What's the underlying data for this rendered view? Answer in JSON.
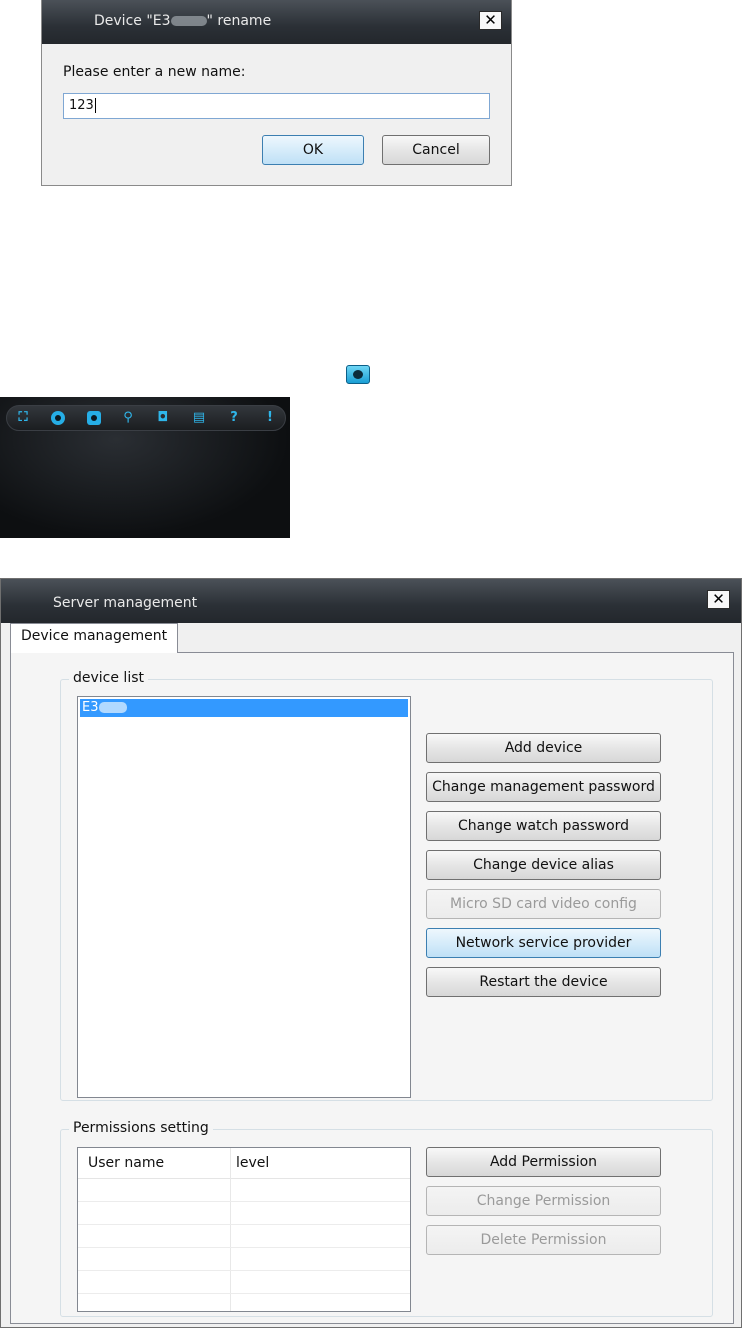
{
  "rename_dialog": {
    "title_prefix": "Device \"E3",
    "title_suffix": "\" rename",
    "close_label": "✕",
    "prompt": "Please enter a new name:",
    "input_value": "123",
    "ok_label": "OK",
    "cancel_label": "Cancel"
  },
  "toolbar": {
    "icons": [
      "fullscreen-icon",
      "record-icon",
      "snapshot-icon",
      "search-icon",
      "lock-icon",
      "storage-icon",
      "help-icon",
      "alert-icon"
    ],
    "accent": "#26aee6"
  },
  "server_window": {
    "title": "Server management",
    "close_label": "✕",
    "tab_label": "Device management",
    "device_group_label": "device list",
    "devices": [
      {
        "name_prefix": "E3"
      }
    ],
    "device_buttons": {
      "add": "Add device",
      "change_mgmt_pwd": "Change management password",
      "change_watch_pwd": "Change watch password",
      "change_alias": "Change device alias",
      "sd_config": "Micro SD card video config",
      "network_provider": "Network service provider",
      "restart": "Restart the device"
    },
    "permissions_group_label": "Permissions setting",
    "columns": [
      "User name",
      "level"
    ],
    "permission_buttons": {
      "add": "Add Permission",
      "change": "Change Permission",
      "delete": "Delete Permission"
    },
    "selection_color": "#3399ff"
  }
}
